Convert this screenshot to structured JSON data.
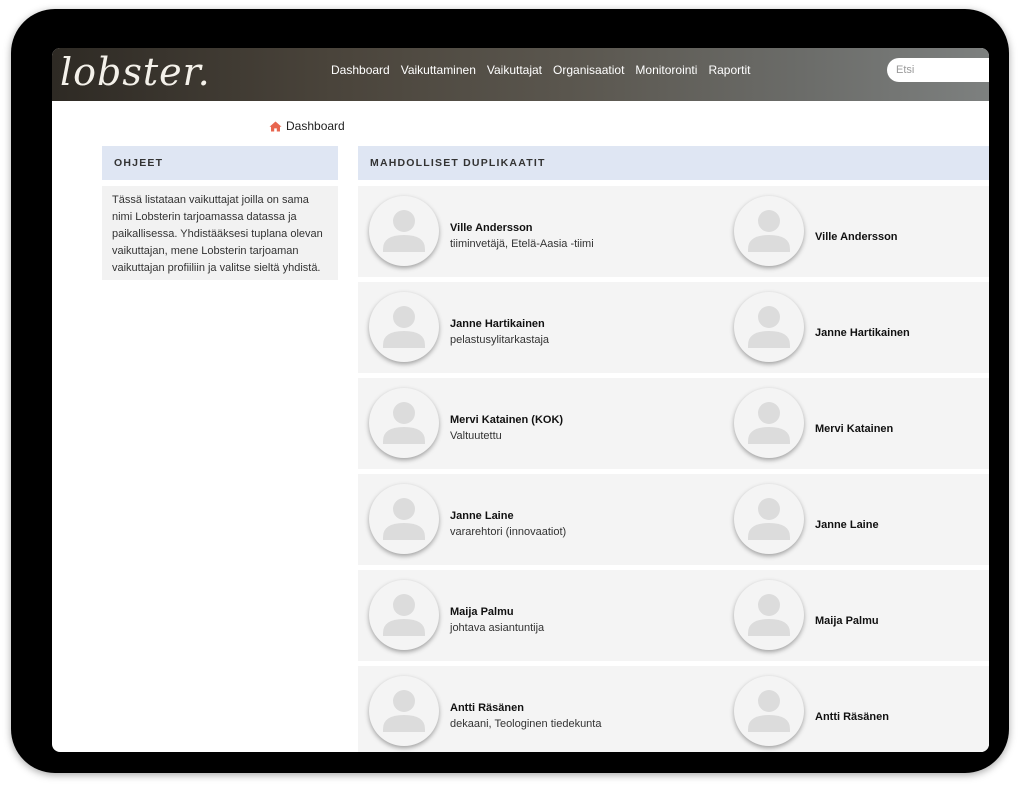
{
  "app": {
    "logo": "lobster.",
    "nav": [
      "Dashboard",
      "Vaikuttaminen",
      "Vaikuttajat",
      "Organisaatiot",
      "Monitorointi",
      "Raportit"
    ],
    "search_placeholder": "Etsi"
  },
  "breadcrumb": {
    "label": "Dashboard"
  },
  "sidebar": {
    "heading": "OHJEET",
    "text": "Tässä listataan vaikuttajat joilla on sama nimi Lobsterin tarjoamassa datassa ja paikallisessa. Yhdistääksesi tuplana olevan vaikuttajan, mene Lobsterin tarjoaman vaikuttajan profiiliin ja valitse sieltä yhdistä."
  },
  "main": {
    "heading": "MAHDOLLISET DUPLIKAATIT",
    "duplicates": [
      {
        "left_name": "Ville Andersson",
        "left_title": "tiiminvetäjä, Etelä-Aasia -tiimi",
        "right_name": "Ville Andersson"
      },
      {
        "left_name": "Janne Hartikainen",
        "left_title": "pelastusylitarkastaja",
        "right_name": "Janne Hartikainen"
      },
      {
        "left_name": "Mervi Katainen (KOK)",
        "left_title": "Valtuutettu",
        "right_name": "Mervi Katainen"
      },
      {
        "left_name": "Janne Laine",
        "left_title": "vararehtori (innovaatiot)",
        "right_name": "Janne Laine"
      },
      {
        "left_name": "Maija Palmu",
        "left_title": "johtava asiantuntija",
        "right_name": "Maija Palmu"
      },
      {
        "left_name": "Antti Räsänen",
        "left_title": "dekaani, Teologinen tiedekunta",
        "right_name": "Antti Räsänen"
      }
    ]
  },
  "colors": {
    "home_icon": "#e8664f",
    "panel_header": "#dfe6f3"
  }
}
